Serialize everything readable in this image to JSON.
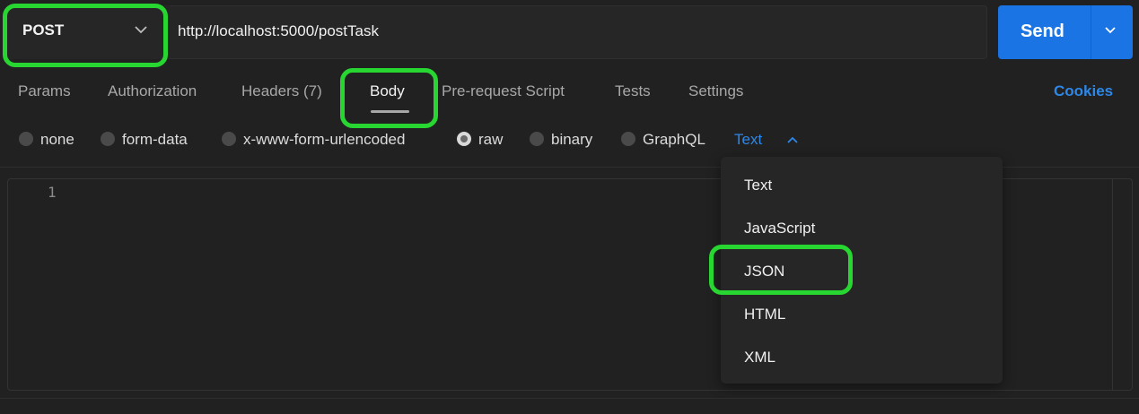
{
  "request": {
    "method": "POST",
    "url": "http://localhost:5000/postTask",
    "send_label": "Send"
  },
  "tabs": [
    {
      "label": "Params"
    },
    {
      "label": "Authorization"
    },
    {
      "label": "Headers (7)"
    },
    {
      "label": "Body"
    },
    {
      "label": "Pre-request Script"
    },
    {
      "label": "Tests"
    },
    {
      "label": "Settings"
    }
  ],
  "active_tab": "Body",
  "cookies_label": "Cookies",
  "body_types": [
    {
      "label": "none"
    },
    {
      "label": "form-data"
    },
    {
      "label": "x-www-form-urlencoded"
    },
    {
      "label": "raw"
    },
    {
      "label": "binary"
    },
    {
      "label": "GraphQL"
    }
  ],
  "selected_body_type": "raw",
  "raw_format": "Text",
  "editor": {
    "line_numbers": [
      "1"
    ]
  },
  "format_menu": {
    "items": [
      {
        "label": "Text"
      },
      {
        "label": "JavaScript"
      },
      {
        "label": "JSON"
      },
      {
        "label": "HTML"
      },
      {
        "label": "XML"
      }
    ]
  },
  "colors": {
    "background": "#212121",
    "accent_blue": "#1b74e4",
    "link_blue": "#2d87e8",
    "highlight_green": "#28d631"
  }
}
